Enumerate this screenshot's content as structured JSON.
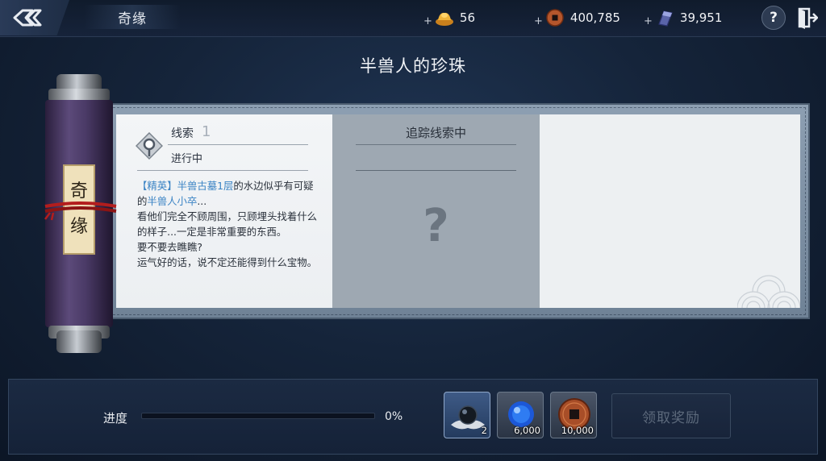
{
  "header": {
    "title": "奇缘",
    "currencies": [
      {
        "icon": "gold-ingot-icon",
        "value": "56"
      },
      {
        "icon": "copper-coin-icon",
        "value": "400,785"
      },
      {
        "icon": "silver-bar-icon",
        "value": "39,951"
      }
    ],
    "plus": "+",
    "help": "?"
  },
  "quest": {
    "title": "半兽人的珍珠",
    "scroll_label_1": "奇",
    "scroll_label_2": "缘",
    "clue_label": "线索",
    "clue_number": "1",
    "clue_status": "进行中",
    "clue_text": {
      "bracket_open": "【",
      "tag": "精英",
      "bracket_close": "】",
      "location": "半兽古墓1层",
      "part1": "的水边似乎有可疑的",
      "monster": "半兽人小卒",
      "part2": "...",
      "line3": "看他们完全不顾周围，只顾埋头找着什么的样子...一定是非常重要的东西。",
      "line4": "要不要去瞧瞧?",
      "line5": "运气好的话，说不定还能得到什么宝物。"
    },
    "tracking_title": "追踪线索中",
    "tracking_placeholder": "?"
  },
  "progress": {
    "label": "进度",
    "percent_text": "0%",
    "fraction": 0
  },
  "rewards": [
    {
      "icon": "black-pearl-icon",
      "qty": "2"
    },
    {
      "icon": "blue-orb-icon",
      "qty": "6,000"
    },
    {
      "icon": "copper-coin-icon",
      "qty": "10,000"
    }
  ],
  "claim_button": "领取奖励",
  "colors": {
    "accent_blue": "#3a83c4",
    "progress_fill": "#5fa4e0"
  }
}
